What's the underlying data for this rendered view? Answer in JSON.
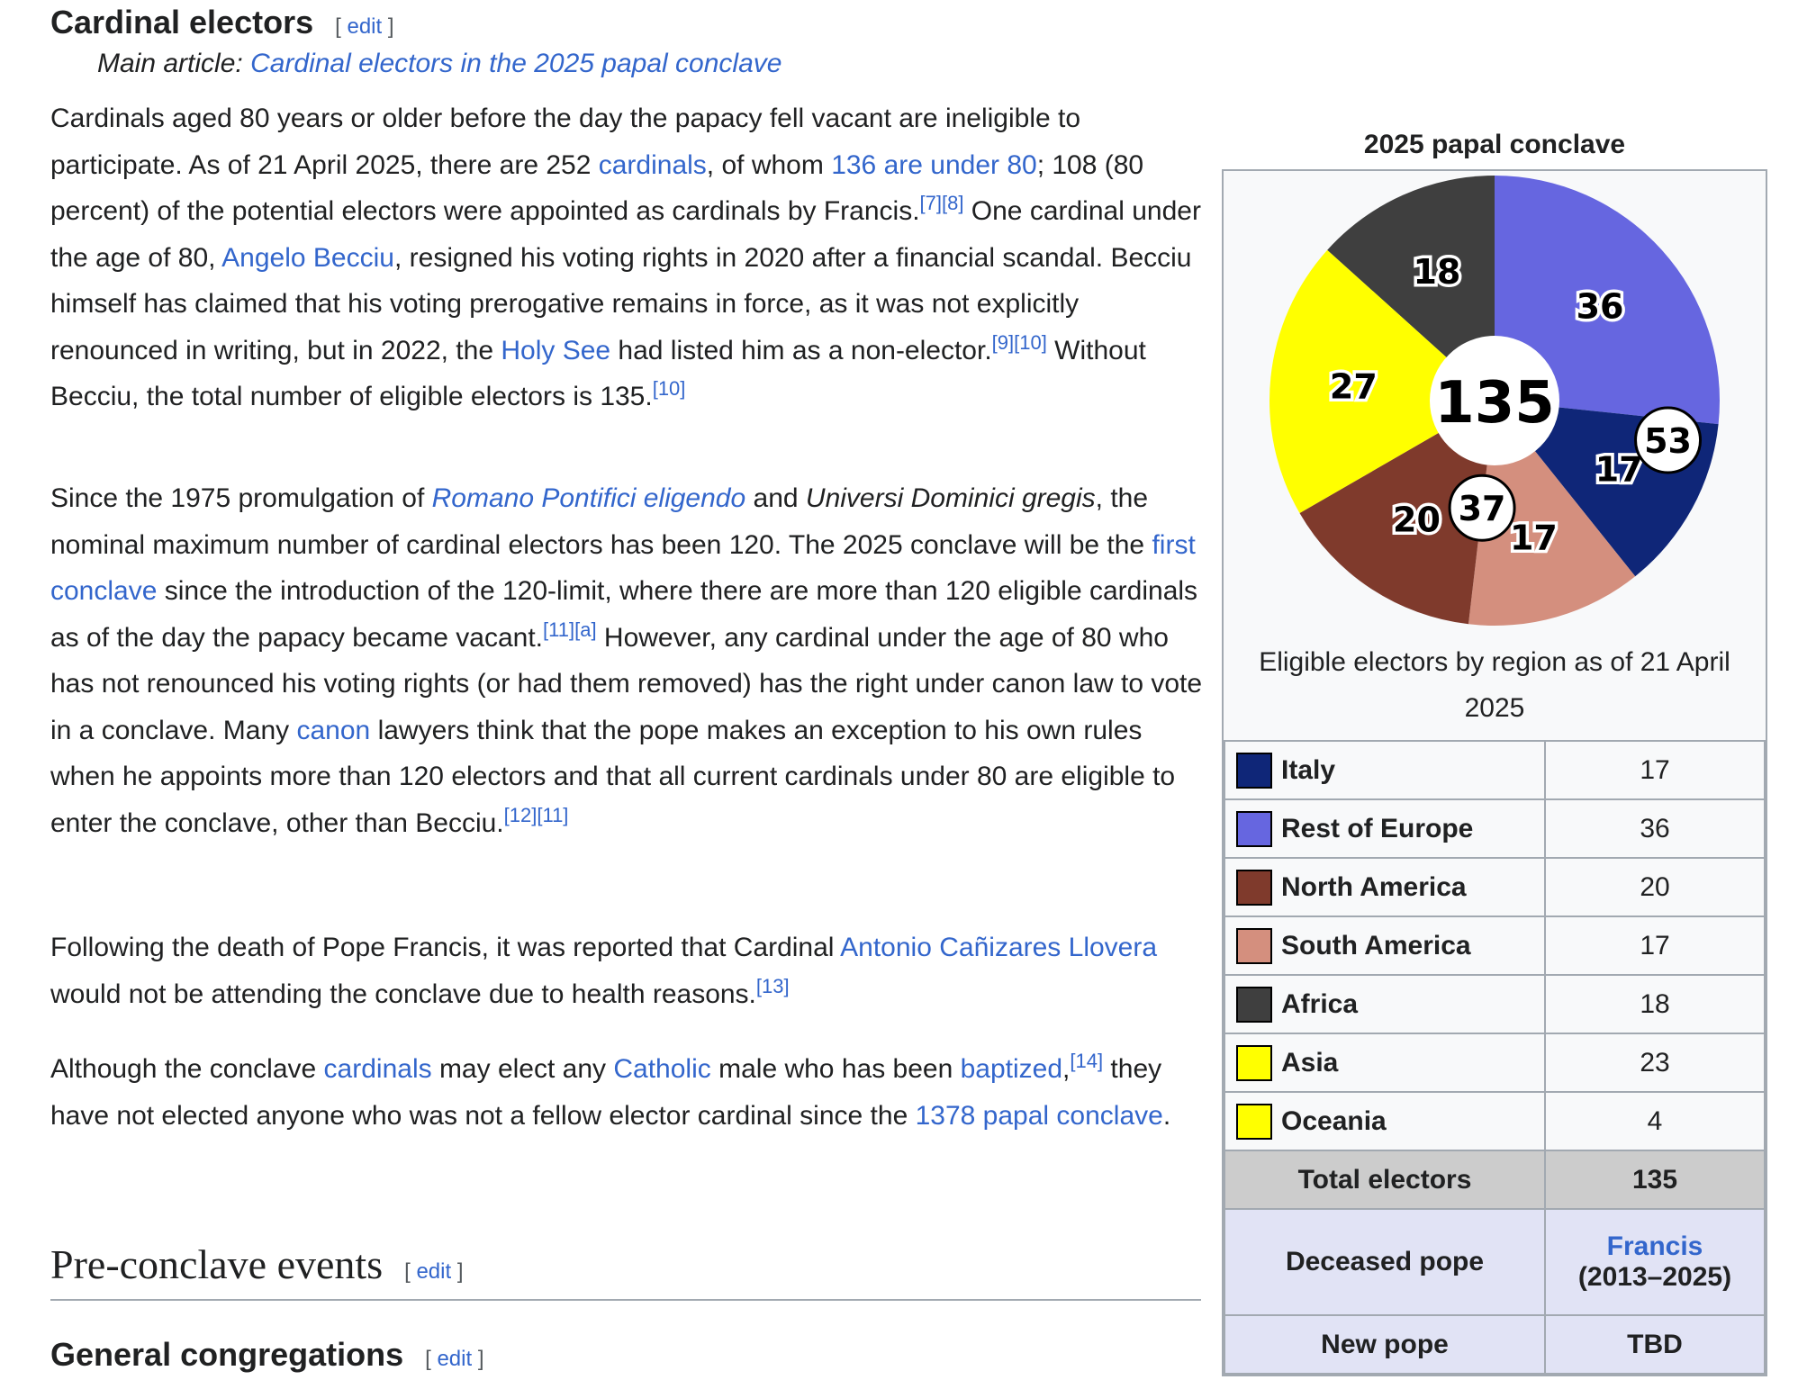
{
  "section": {
    "title": "Cardinal electors",
    "edit": "edit",
    "hatnote_prefix": "Main article: ",
    "hatnote_link": "Cardinal electors in the 2025 papal conclave"
  },
  "p1": {
    "t1": "Cardinals aged 80 years or older before the day the papacy fell vacant are ineligible to participate. As of 21 April 2025, there are 252 ",
    "l1": "cardinals",
    "t2": ", of whom ",
    "l2": "136 are under 80",
    "t3": "; 108 (80 percent) of the potential electors were appointed as cardinals by Francis.",
    "r1": "[7][8]",
    "t4": " One cardinal under the age of 80, ",
    "l3": "Angelo Becciu",
    "t5": ", resigned his voting rights in 2020 after a financial scandal. Becciu himself has claimed that his voting prerogative remains in force, as it was not explicitly renounced in writing, but in 2022, the ",
    "l4": "Holy See",
    "t6": " had listed him as a non-elector.",
    "r2": "[9][10]",
    "t7": " Without Becciu, the total number of eligible electors is 135.",
    "r3": "[10]"
  },
  "p2": {
    "t1": "Since the 1975 promulgation of ",
    "l1": "Romano Pontifici eligendo",
    "t2": " and ",
    "i1": "Universi Dominici gregis",
    "t3": ", the nominal maximum number of cardinal electors has been 120. The 2025 conclave will be the ",
    "l2": "first conclave",
    "t4": " since the introduction of the 120-limit, where there are more than 120 eligible cardinals as of the day the papacy became vacant.",
    "r1": "[11][a]",
    "t5": " However, any cardinal under the age of 80 who has not renounced his voting rights (or had them removed) has the right under canon law to vote in a conclave. Many ",
    "l3": "canon",
    "t6": " lawyers think that the pope makes an exception to his own rules when he appoints more than 120 electors and that all current cardinals under 80 are eligible to enter the conclave, other than Becciu.",
    "r2": "[12][11]"
  },
  "p3": {
    "t1": "Following the death of Pope Francis, it was reported that Cardinal ",
    "l1": "Antonio Cañizares Llovera",
    "t2": " would not be attending the conclave due to health reasons.",
    "r1": "[13]"
  },
  "p4": {
    "t1": "Although the conclave ",
    "l1": "cardinals",
    "t2": " may elect any ",
    "l2": "Catholic",
    "t3": " male who has been ",
    "l3": "baptized",
    "t4": ",",
    "r1": "[14]",
    "t5": " they have not elected anyone who was not a fellow elector cardinal since the ",
    "l4": "1378 papal conclave",
    "t6": "."
  },
  "h_preconclave": {
    "title": "Pre-conclave events",
    "edit": "edit"
  },
  "h_congregations": {
    "title": "General congregations",
    "edit": "edit"
  },
  "infobox": {
    "title": "2025 papal conclave",
    "caption": "Eligible electors by region as of 21 April 2025",
    "rows": [
      {
        "label": "Italy",
        "value": "17",
        "color": "#0f2678"
      },
      {
        "label": "Rest of Europe",
        "value": "36",
        "color": "#6666e0"
      },
      {
        "label": "North America",
        "value": "20",
        "color": "#7f3a2c"
      },
      {
        "label": "South America",
        "value": "17",
        "color": "#d48f7e"
      },
      {
        "label": "Africa",
        "value": "18",
        "color": "#3f3f3f"
      },
      {
        "label": "Asia",
        "value": "23",
        "color": "#ffff00"
      },
      {
        "label": "Oceania",
        "value": "4",
        "color": "#ffff00"
      }
    ],
    "total_label": "Total electors",
    "total_value": "135",
    "deceased_label": "Deceased pope",
    "deceased_link": "Francis",
    "deceased_years": "(2013–2025)",
    "new_label": "New pope",
    "new_value": "TBD"
  },
  "chart_data": {
    "type": "pie",
    "title": "2025 papal conclave",
    "center_label": "135",
    "slices": [
      {
        "label": "Rest of Europe",
        "value": 36,
        "color": "#6666e0"
      },
      {
        "label": "Italy",
        "value": 17,
        "color": "#0f2678"
      },
      {
        "label": "South America",
        "value": 17,
        "color": "#d48f7e"
      },
      {
        "label": "North America",
        "value": 20,
        "color": "#7f3a2c"
      },
      {
        "label": "Asia + Oceania",
        "value": 27,
        "color": "#ffff00"
      },
      {
        "label": "Africa",
        "value": 18,
        "color": "#3f3f3f"
      }
    ],
    "group_labels": [
      {
        "label": "53",
        "group": "Europe",
        "value": 53
      },
      {
        "label": "37",
        "group": "Americas",
        "value": 37
      }
    ]
  }
}
